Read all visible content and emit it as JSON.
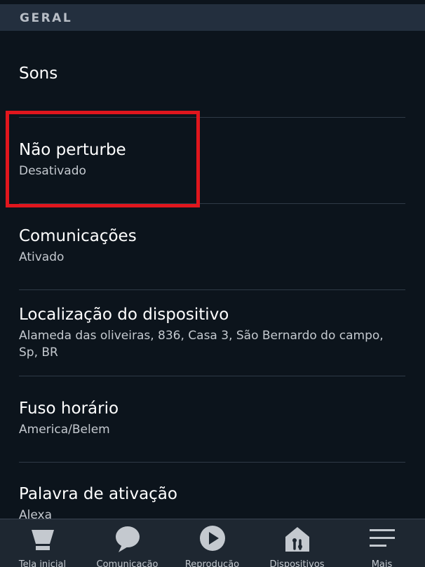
{
  "section": {
    "title": "GERAL"
  },
  "settings": [
    {
      "title": "Sons"
    },
    {
      "title": "Não perturbe",
      "subtitle": "Desativado"
    },
    {
      "title": "Comunicações",
      "subtitle": "Ativado"
    },
    {
      "title": "Localização do dispositivo",
      "subtitle": "Alameda das oliveiras, 836, Casa 3, São Bernardo do campo, Sp, BR"
    },
    {
      "title": "Fuso horário",
      "subtitle": "America/Belem"
    },
    {
      "title": "Palavra de ativação",
      "subtitle": "Alexa"
    }
  ],
  "nav": [
    {
      "label": "Tela inicial",
      "icon": "home-icon"
    },
    {
      "label": "Comunicação",
      "icon": "speech-bubble-icon"
    },
    {
      "label": "Reprodução",
      "icon": "play-icon"
    },
    {
      "label": "Dispositivos",
      "icon": "devices-icon"
    },
    {
      "label": "Mais",
      "icon": "menu-icon"
    }
  ],
  "colors": {
    "background": "#0c141c",
    "section_header": "#232f3e",
    "highlight": "#e0161d",
    "nav_background": "#1e2731"
  }
}
